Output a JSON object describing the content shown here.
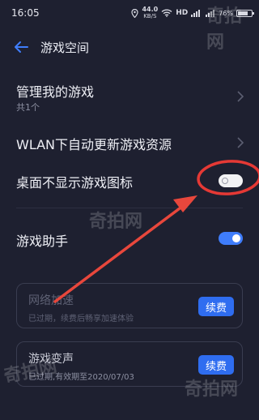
{
  "status_bar": {
    "time": "16:05",
    "net_speed_value": "44.0",
    "net_speed_unit": "KB/S",
    "network_label": "HD",
    "battery_text": "76%"
  },
  "header": {
    "back_icon": "back-arrow-icon",
    "title": "游戏空间"
  },
  "rows": {
    "manage_games": {
      "title": "管理我的游戏",
      "subtitle": "共1个"
    },
    "wlan_update": {
      "title": "WLAN下自动更新游戏资源"
    },
    "hide_desktop_icon": {
      "title": "桌面不显示游戏图标",
      "toggle_state": "off"
    },
    "game_assistant": {
      "title": "游戏助手",
      "toggle_state": "on"
    }
  },
  "cards": {
    "network_acceleration": {
      "title": "网络加速",
      "subtitle": "已过期，续费后畅享加速体验",
      "button_label": "续费",
      "enabled": false
    },
    "voice_changer": {
      "title": "游戏变声",
      "subtitle": "已过期,有效期至2020/07/03",
      "button_label": "续费",
      "enabled": true
    }
  },
  "annotations": {
    "highlight_color": "#e53935",
    "arrow_color": "#e8473c"
  },
  "watermark": {
    "text_a": "奇拍网",
    "text_b": "奇拍网",
    "text_c": "奇拍网",
    "text_d": "奇拍网"
  },
  "colors": {
    "background": "#1e2030",
    "accent": "#3f7dfb",
    "button": "#2f6df0"
  }
}
